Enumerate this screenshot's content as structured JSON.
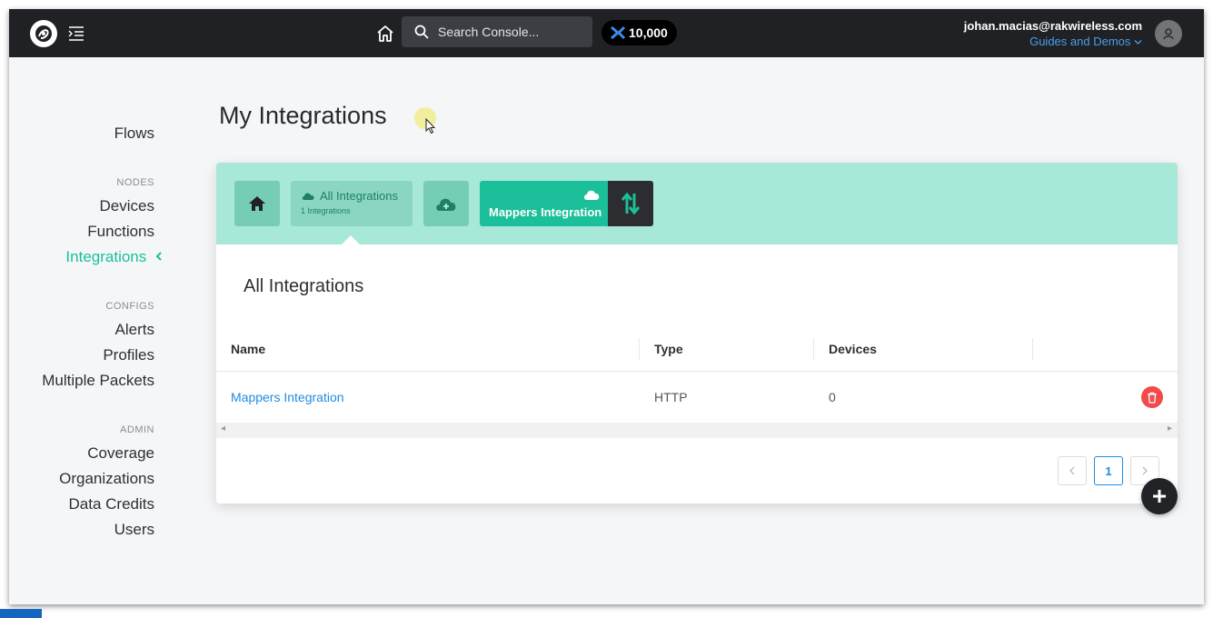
{
  "topbar": {
    "search_placeholder": "Search Console...",
    "data_credits": "10,000",
    "user_email": "johan.macias@rakwireless.com",
    "guides_label": "Guides and Demos"
  },
  "sidebar": {
    "flows": "Flows",
    "nodes_heading": "NODES",
    "devices": "Devices",
    "functions": "Functions",
    "integrations": "Integrations",
    "configs_heading": "CONFIGS",
    "alerts": "Alerts",
    "profiles": "Profiles",
    "multiple_packets": "Multiple Packets",
    "admin_heading": "ADMIN",
    "coverage": "Coverage",
    "organizations": "Organizations",
    "data_credits": "Data Credits",
    "users": "Users"
  },
  "main": {
    "page_title": "My Integrations",
    "tabs": {
      "all_label": "All Integrations",
      "all_count": "1 Integrations",
      "mappers_label": "Mappers Integration"
    },
    "section_title": "All Integrations",
    "table": {
      "columns": [
        "Name",
        "Type",
        "Devices"
      ],
      "rows": [
        {
          "name": "Mappers Integration",
          "type": "HTTP",
          "devices": "0"
        }
      ]
    },
    "pagination": {
      "current": "1"
    }
  },
  "colors": {
    "accent": "#1bbf99",
    "header_bg": "#a7e8d8",
    "link": "#1f8ce0",
    "danger": "#f04a4a"
  }
}
